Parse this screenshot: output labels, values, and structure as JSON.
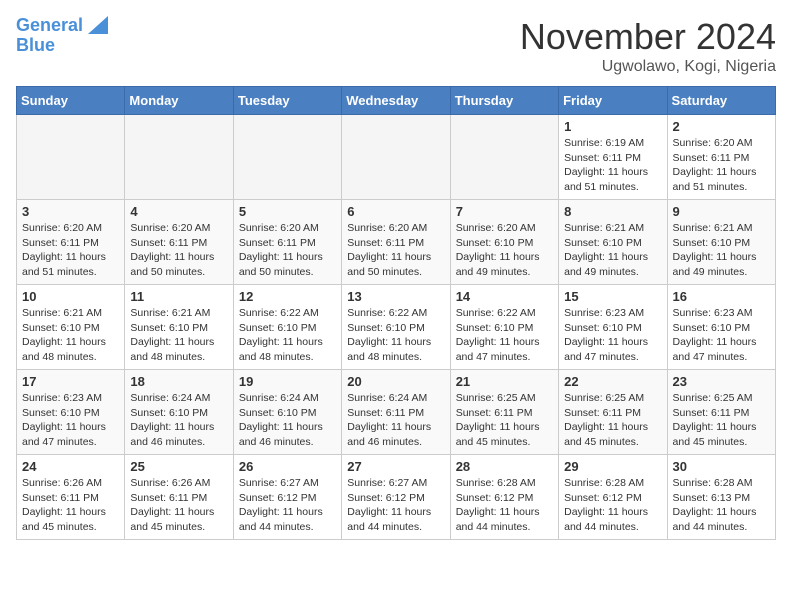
{
  "header": {
    "logo_line1": "General",
    "logo_line2": "Blue",
    "month": "November 2024",
    "location": "Ugwolawo, Kogi, Nigeria"
  },
  "days_of_week": [
    "Sunday",
    "Monday",
    "Tuesday",
    "Wednesday",
    "Thursday",
    "Friday",
    "Saturday"
  ],
  "weeks": [
    [
      {
        "day": "",
        "info": ""
      },
      {
        "day": "",
        "info": ""
      },
      {
        "day": "",
        "info": ""
      },
      {
        "day": "",
        "info": ""
      },
      {
        "day": "",
        "info": ""
      },
      {
        "day": "1",
        "info": "Sunrise: 6:19 AM\nSunset: 6:11 PM\nDaylight: 11 hours and 51 minutes."
      },
      {
        "day": "2",
        "info": "Sunrise: 6:20 AM\nSunset: 6:11 PM\nDaylight: 11 hours and 51 minutes."
      }
    ],
    [
      {
        "day": "3",
        "info": "Sunrise: 6:20 AM\nSunset: 6:11 PM\nDaylight: 11 hours and 51 minutes."
      },
      {
        "day": "4",
        "info": "Sunrise: 6:20 AM\nSunset: 6:11 PM\nDaylight: 11 hours and 50 minutes."
      },
      {
        "day": "5",
        "info": "Sunrise: 6:20 AM\nSunset: 6:11 PM\nDaylight: 11 hours and 50 minutes."
      },
      {
        "day": "6",
        "info": "Sunrise: 6:20 AM\nSunset: 6:11 PM\nDaylight: 11 hours and 50 minutes."
      },
      {
        "day": "7",
        "info": "Sunrise: 6:20 AM\nSunset: 6:10 PM\nDaylight: 11 hours and 49 minutes."
      },
      {
        "day": "8",
        "info": "Sunrise: 6:21 AM\nSunset: 6:10 PM\nDaylight: 11 hours and 49 minutes."
      },
      {
        "day": "9",
        "info": "Sunrise: 6:21 AM\nSunset: 6:10 PM\nDaylight: 11 hours and 49 minutes."
      }
    ],
    [
      {
        "day": "10",
        "info": "Sunrise: 6:21 AM\nSunset: 6:10 PM\nDaylight: 11 hours and 48 minutes."
      },
      {
        "day": "11",
        "info": "Sunrise: 6:21 AM\nSunset: 6:10 PM\nDaylight: 11 hours and 48 minutes."
      },
      {
        "day": "12",
        "info": "Sunrise: 6:22 AM\nSunset: 6:10 PM\nDaylight: 11 hours and 48 minutes."
      },
      {
        "day": "13",
        "info": "Sunrise: 6:22 AM\nSunset: 6:10 PM\nDaylight: 11 hours and 48 minutes."
      },
      {
        "day": "14",
        "info": "Sunrise: 6:22 AM\nSunset: 6:10 PM\nDaylight: 11 hours and 47 minutes."
      },
      {
        "day": "15",
        "info": "Sunrise: 6:23 AM\nSunset: 6:10 PM\nDaylight: 11 hours and 47 minutes."
      },
      {
        "day": "16",
        "info": "Sunrise: 6:23 AM\nSunset: 6:10 PM\nDaylight: 11 hours and 47 minutes."
      }
    ],
    [
      {
        "day": "17",
        "info": "Sunrise: 6:23 AM\nSunset: 6:10 PM\nDaylight: 11 hours and 47 minutes."
      },
      {
        "day": "18",
        "info": "Sunrise: 6:24 AM\nSunset: 6:10 PM\nDaylight: 11 hours and 46 minutes."
      },
      {
        "day": "19",
        "info": "Sunrise: 6:24 AM\nSunset: 6:10 PM\nDaylight: 11 hours and 46 minutes."
      },
      {
        "day": "20",
        "info": "Sunrise: 6:24 AM\nSunset: 6:11 PM\nDaylight: 11 hours and 46 minutes."
      },
      {
        "day": "21",
        "info": "Sunrise: 6:25 AM\nSunset: 6:11 PM\nDaylight: 11 hours and 45 minutes."
      },
      {
        "day": "22",
        "info": "Sunrise: 6:25 AM\nSunset: 6:11 PM\nDaylight: 11 hours and 45 minutes."
      },
      {
        "day": "23",
        "info": "Sunrise: 6:25 AM\nSunset: 6:11 PM\nDaylight: 11 hours and 45 minutes."
      }
    ],
    [
      {
        "day": "24",
        "info": "Sunrise: 6:26 AM\nSunset: 6:11 PM\nDaylight: 11 hours and 45 minutes."
      },
      {
        "day": "25",
        "info": "Sunrise: 6:26 AM\nSunset: 6:11 PM\nDaylight: 11 hours and 45 minutes."
      },
      {
        "day": "26",
        "info": "Sunrise: 6:27 AM\nSunset: 6:12 PM\nDaylight: 11 hours and 44 minutes."
      },
      {
        "day": "27",
        "info": "Sunrise: 6:27 AM\nSunset: 6:12 PM\nDaylight: 11 hours and 44 minutes."
      },
      {
        "day": "28",
        "info": "Sunrise: 6:28 AM\nSunset: 6:12 PM\nDaylight: 11 hours and 44 minutes."
      },
      {
        "day": "29",
        "info": "Sunrise: 6:28 AM\nSunset: 6:12 PM\nDaylight: 11 hours and 44 minutes."
      },
      {
        "day": "30",
        "info": "Sunrise: 6:28 AM\nSunset: 6:13 PM\nDaylight: 11 hours and 44 minutes."
      }
    ]
  ]
}
